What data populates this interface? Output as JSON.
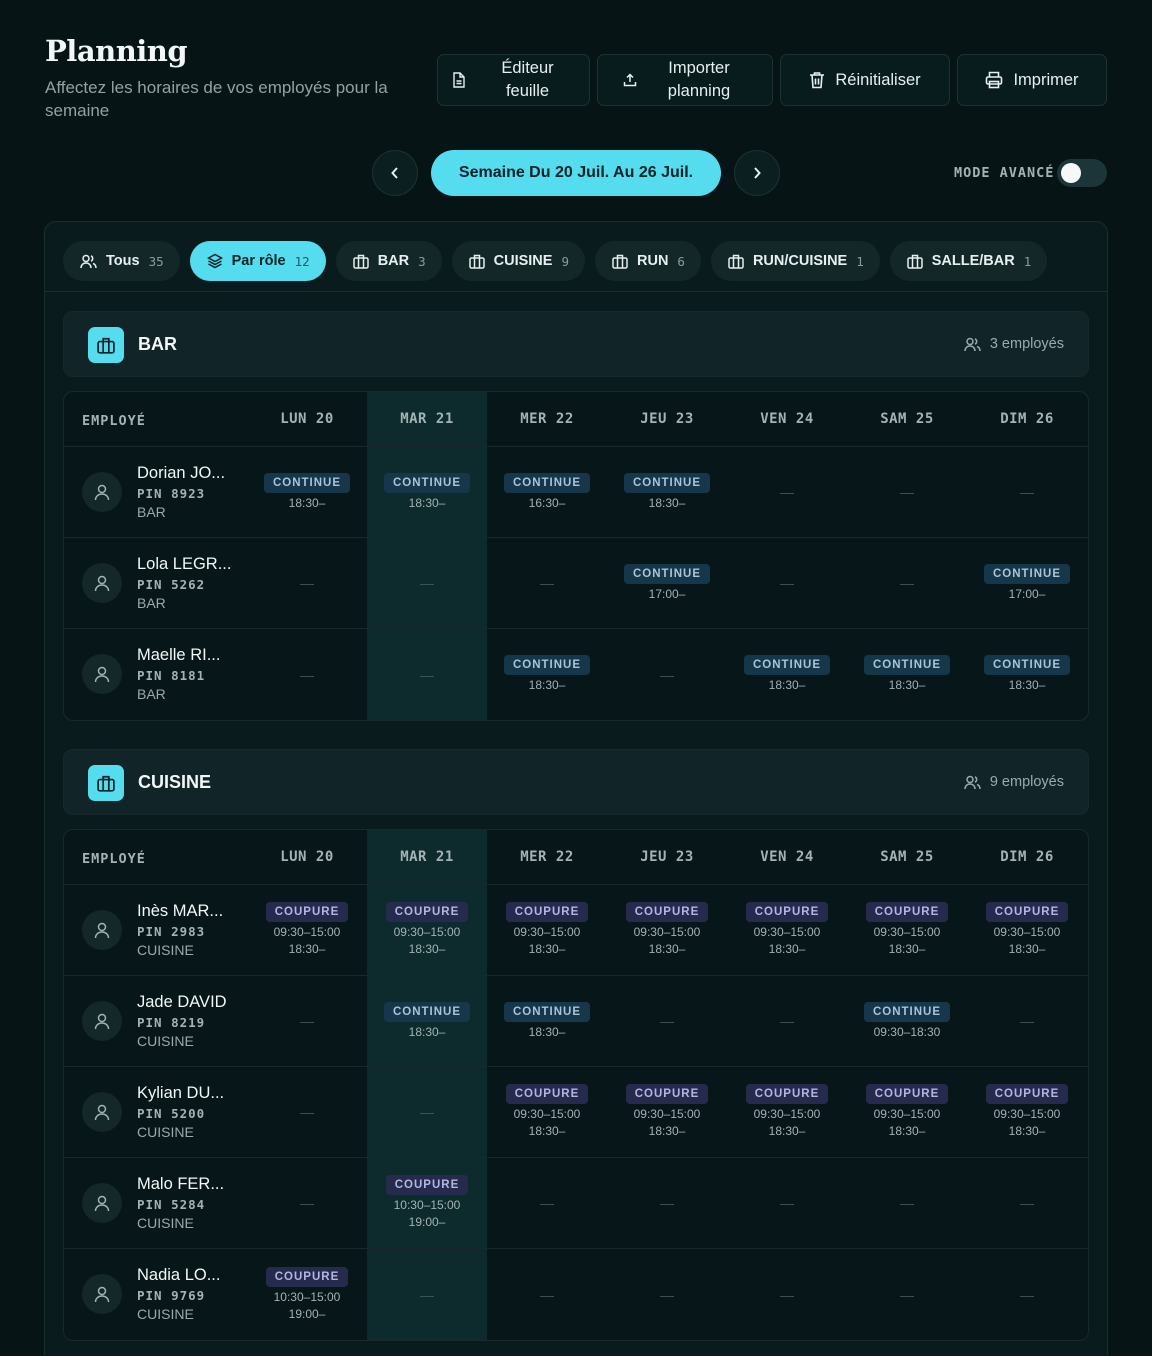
{
  "header": {
    "title": "Planning",
    "subtitle": "Affectez les horaires de vos employés pour la semaine"
  },
  "toolbar": {
    "editor_label": "Éditeur feuille",
    "import_label": "Importer planning",
    "reset_label": "Réinitialiser",
    "print_label": "Imprimer"
  },
  "week": {
    "label": "Semaine Du 20 Juil. Au 26 Juil."
  },
  "mode": {
    "label": "MODE AVANCÉ",
    "enabled": false
  },
  "filters": [
    {
      "label": "Tous",
      "count": "35",
      "icon": "users-icon",
      "active": false
    },
    {
      "label": "Par rôle",
      "count": "12",
      "icon": "layers-icon",
      "active": true
    },
    {
      "label": "BAR",
      "count": "3",
      "icon": "briefcase-icon",
      "active": false
    },
    {
      "label": "CUISINE",
      "count": "9",
      "icon": "briefcase-icon",
      "active": false
    },
    {
      "label": "RUN",
      "count": "6",
      "icon": "briefcase-icon",
      "active": false
    },
    {
      "label": "RUN/CUISINE",
      "count": "1",
      "icon": "briefcase-icon",
      "active": false
    },
    {
      "label": "SALLE/BAR",
      "count": "1",
      "icon": "briefcase-icon",
      "active": false
    }
  ],
  "table": {
    "employee_header": "EMPLOYÉ",
    "days": [
      "LUN 20",
      "MAR 21",
      "MER 22",
      "JEU 23",
      "VEN 24",
      "SAM 25",
      "DIM 26"
    ],
    "highlight_day_index": 1,
    "empty_cell": "—"
  },
  "groups": [
    {
      "name": "BAR",
      "count_label": "3 employés",
      "employees": [
        {
          "name": "Dorian JO...",
          "pin": "PIN 8923",
          "role": "BAR",
          "shifts": [
            {
              "type": "CONTINUE",
              "times": [
                "18:30–"
              ]
            },
            {
              "type": "CONTINUE",
              "times": [
                "18:30–"
              ]
            },
            {
              "type": "CONTINUE",
              "times": [
                "16:30–"
              ]
            },
            {
              "type": "CONTINUE",
              "times": [
                "18:30–"
              ]
            },
            null,
            null,
            null
          ]
        },
        {
          "name": "Lola LEGR...",
          "pin": "PIN 5262",
          "role": "BAR",
          "shifts": [
            null,
            null,
            null,
            {
              "type": "CONTINUE",
              "times": [
                "17:00–"
              ]
            },
            null,
            null,
            {
              "type": "CONTINUE",
              "times": [
                "17:00–"
              ]
            }
          ]
        },
        {
          "name": "Maelle RI...",
          "pin": "PIN 8181",
          "role": "BAR",
          "shifts": [
            null,
            null,
            {
              "type": "CONTINUE",
              "times": [
                "18:30–"
              ]
            },
            null,
            {
              "type": "CONTINUE",
              "times": [
                "18:30–"
              ]
            },
            {
              "type": "CONTINUE",
              "times": [
                "18:30–"
              ]
            },
            {
              "type": "CONTINUE",
              "times": [
                "18:30–"
              ]
            }
          ]
        }
      ]
    },
    {
      "name": "CUISINE",
      "count_label": "9 employés",
      "employees": [
        {
          "name": "Inès MAR...",
          "pin": "PIN 2983",
          "role": "CUISINE",
          "shifts": [
            {
              "type": "COUPURE",
              "times": [
                "09:30–15:00",
                "18:30–"
              ]
            },
            {
              "type": "COUPURE",
              "times": [
                "09:30–15:00",
                "18:30–"
              ]
            },
            {
              "type": "COUPURE",
              "times": [
                "09:30–15:00",
                "18:30–"
              ]
            },
            {
              "type": "COUPURE",
              "times": [
                "09:30–15:00",
                "18:30–"
              ]
            },
            {
              "type": "COUPURE",
              "times": [
                "09:30–15:00",
                "18:30–"
              ]
            },
            {
              "type": "COUPURE",
              "times": [
                "09:30–15:00",
                "18:30–"
              ]
            },
            {
              "type": "COUPURE",
              "times": [
                "09:30–15:00",
                "18:30–"
              ]
            }
          ]
        },
        {
          "name": "Jade DAVID",
          "pin": "PIN 8219",
          "role": "CUISINE",
          "shifts": [
            null,
            {
              "type": "CONTINUE",
              "times": [
                "18:30–"
              ]
            },
            {
              "type": "CONTINUE",
              "times": [
                "18:30–"
              ]
            },
            null,
            null,
            {
              "type": "CONTINUE",
              "times": [
                "09:30–18:30"
              ]
            },
            null
          ]
        },
        {
          "name": "Kylian DU...",
          "pin": "PIN 5200",
          "role": "CUISINE",
          "shifts": [
            null,
            null,
            {
              "type": "COUPURE",
              "times": [
                "09:30–15:00",
                "18:30–"
              ]
            },
            {
              "type": "COUPURE",
              "times": [
                "09:30–15:00",
                "18:30–"
              ]
            },
            {
              "type": "COUPURE",
              "times": [
                "09:30–15:00",
                "18:30–"
              ]
            },
            {
              "type": "COUPURE",
              "times": [
                "09:30–15:00",
                "18:30–"
              ]
            },
            {
              "type": "COUPURE",
              "times": [
                "09:30–15:00",
                "18:30–"
              ]
            }
          ]
        },
        {
          "name": "Malo FER...",
          "pin": "PIN 5284",
          "role": "CUISINE",
          "shifts": [
            null,
            {
              "type": "COUPURE",
              "times": [
                "10:30–15:00",
                "19:00–"
              ]
            },
            null,
            null,
            null,
            null,
            null
          ]
        },
        {
          "name": "Nadia LO...",
          "pin": "PIN 9769",
          "role": "CUISINE",
          "shifts": [
            {
              "type": "COUPURE",
              "times": [
                "10:30–15:00",
                "19:00–"
              ]
            },
            null,
            null,
            null,
            null,
            null,
            null
          ]
        }
      ]
    }
  ],
  "colors": {
    "background": "#061416",
    "accent": "#55dcef",
    "continue_badge": "#16364a",
    "coupure_badge": "#262a4d"
  }
}
